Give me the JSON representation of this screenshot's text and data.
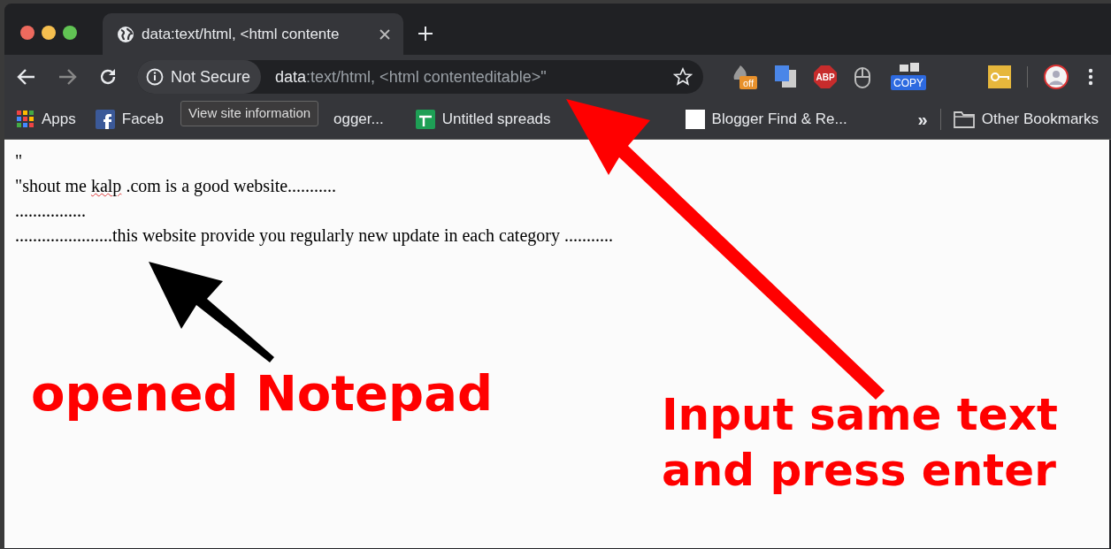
{
  "tab": {
    "title": "data:text/html, <html contente",
    "selected": true
  },
  "address_bar": {
    "security_chip": "Not Secure",
    "url_host": "data",
    "url_rest": ":text/html, <html contenteditable>\""
  },
  "tooltip": "View site information",
  "extensions": [
    {
      "kind": "flame",
      "badge": "off"
    },
    {
      "kind": "translate"
    },
    {
      "kind": "abp",
      "badge": "ABP"
    },
    {
      "kind": "mouse"
    },
    {
      "kind": "copy",
      "badge": "COPY"
    },
    {
      "kind": "key"
    },
    {
      "kind": "avatar"
    }
  ],
  "bookmarks": [
    {
      "kind": "apps",
      "label": "Apps"
    },
    {
      "kind": "facebook",
      "label": "Faceb"
    },
    {
      "kind": "blank",
      "label": "ogger..."
    },
    {
      "kind": "sheets",
      "label": "Untitled spreads"
    },
    {
      "kind": "page",
      "label": "Blogger Find & Re..."
    }
  ],
  "more_bookmarks": "»",
  "other_bookmarks": "Other Bookmarks",
  "document_lines": [
    {
      "segments": [
        {
          "text": "\"",
          "misspelled": false
        }
      ]
    },
    {
      "segments": [
        {
          "text": "\"shout me ",
          "misspelled": false
        },
        {
          "text": "kalp",
          "misspelled": true
        },
        {
          "text": " .com is a good website...........",
          "misspelled": false
        }
      ]
    },
    {
      "segments": [
        {
          "text": "................",
          "misspelled": false
        }
      ]
    },
    {
      "segments": [
        {
          "text": "......................this website provide you regularly new update in each category ...........",
          "misspelled": false
        }
      ]
    }
  ],
  "annotations": [
    {
      "kind": "black",
      "lines": [
        "opened Notepad"
      ]
    },
    {
      "kind": "red",
      "lines": [
        "Input same text",
        "and press enter"
      ]
    }
  ]
}
